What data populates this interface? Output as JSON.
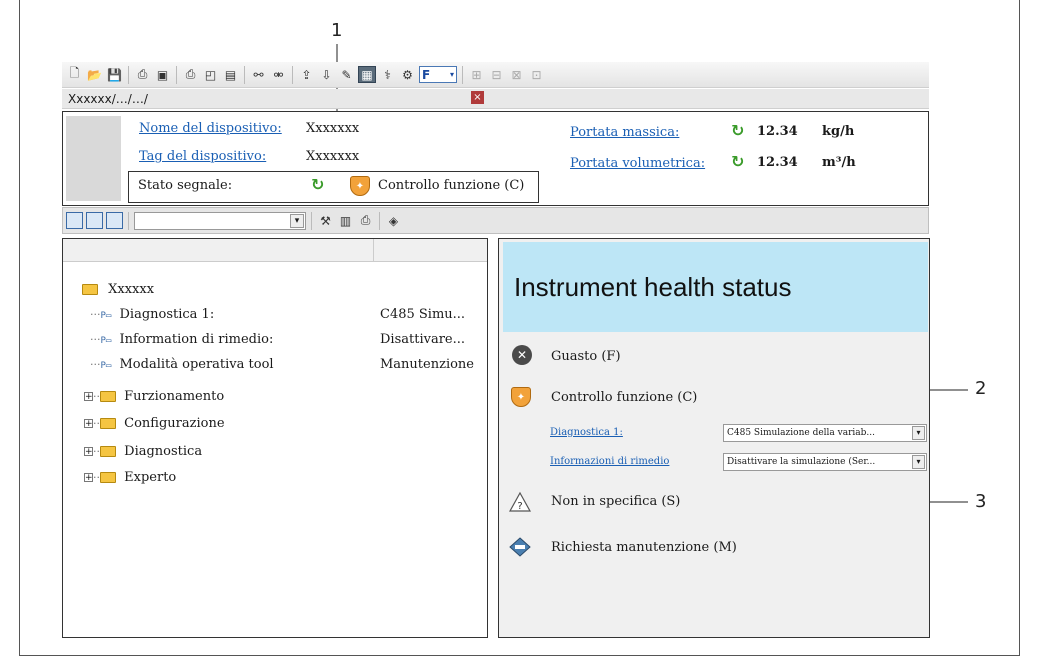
{
  "callouts": {
    "c1": "1",
    "c2": "2",
    "c3": "3"
  },
  "path": {
    "text": "Xxxxxx/…/…/"
  },
  "toolbar2": {
    "combo_value": ""
  },
  "header": {
    "device_name_label": "Nome del dispositivo:",
    "device_name_value": "Xxxxxxx",
    "device_tag_label": "Tag del dispositivo:",
    "device_tag_value": "Xxxxxxx",
    "signal_status_label": "Stato segnale:",
    "signal_status_value": "Controllo funzione (C)",
    "mass_flow_label": "Portata massica:",
    "mass_flow_value": "12.34",
    "mass_flow_unit": "kg/h",
    "vol_flow_label": "Portata volumetrica:",
    "vol_flow_value": "12.34",
    "vol_flow_unit": "m³/h"
  },
  "tree": {
    "root": "Xxxxxx",
    "params": [
      {
        "label": "Diagnostica 1:",
        "value": "C485 Simu..."
      },
      {
        "label": "Information di rimedio:",
        "value": "Disattivare..."
      },
      {
        "label": "Modalità operativa tool",
        "value": "Manutenzione"
      }
    ],
    "folders": [
      "Furzionamento",
      "Configurazione",
      "Diagnostica",
      "Experto"
    ]
  },
  "health": {
    "title": "Instrument health status",
    "failure": "Guasto (F)",
    "function_check": "Controllo funzione (C)",
    "diag_label": "Diagnostica 1:",
    "diag_value": "C485 Simulazione della variab...",
    "remedy_label": "Informazioni di rimedio",
    "remedy_value": "Disattivare la simulazione (Ser...",
    "out_of_spec": "Non in specifica (S)",
    "maintenance": "Richiesta manutenzione (M)"
  }
}
